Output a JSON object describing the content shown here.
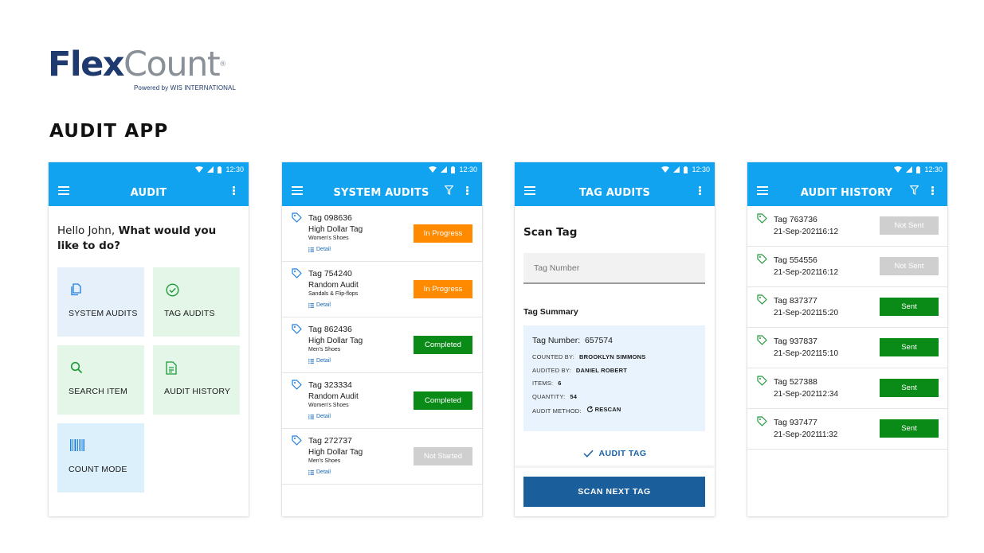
{
  "logo": {
    "part1": "Flex",
    "part2": "Count",
    "tm": "®",
    "tagline": "Powered by WIS INTERNATIONAL"
  },
  "page_title": "AUDIT APP",
  "colors": {
    "appbar": "#12a3f0",
    "in_progress": "#ff8a00",
    "completed": "#0a8a16",
    "not_started": "#cfcfcf",
    "sent": "#0a8a16",
    "not_sent": "#cfcfcf",
    "primary_button": "#1a5f9c",
    "link": "#1769b8"
  },
  "status_bar": {
    "time": "12:30"
  },
  "screen_audit": {
    "title": "AUDIT",
    "greeting_prefix": "Hello John, ",
    "greeting_bold": "What would you like to do?",
    "tiles": [
      {
        "label": "SYSTEM AUDITS",
        "icon": "document-copy-icon"
      },
      {
        "label": "TAG AUDITS",
        "icon": "check-circle-icon"
      },
      {
        "label": "SEARCH ITEM",
        "icon": "search-icon"
      },
      {
        "label": "AUDIT HISTORY",
        "icon": "document-list-icon"
      },
      {
        "label": "COUNT MODE",
        "icon": "barcode-icon"
      }
    ]
  },
  "screen_system_audits": {
    "title": "SYSTEM AUDITS",
    "detail_label": "Detail",
    "items": [
      {
        "tag": "Tag 098636",
        "name": "High Dollar Tag",
        "category": "Women's Shoes",
        "status": "In Progress"
      },
      {
        "tag": "Tag 754240",
        "name": "Random Audit",
        "category": "Sandals & Flip-flops",
        "status": "In Progress"
      },
      {
        "tag": "Tag 862436",
        "name": "High Dollar Tag",
        "category": "Men's Shoes",
        "status": "Completed"
      },
      {
        "tag": "Tag 323334",
        "name": "Random Audit",
        "category": "Women's Shoes",
        "status": "Completed"
      },
      {
        "tag": "Tag 272737",
        "name": "High Dollar Tag",
        "category": "Men's Shoes",
        "status": "Not Started"
      }
    ]
  },
  "screen_tag_audits": {
    "title": "TAG AUDITS",
    "scan_heading": "Scan Tag",
    "input_placeholder": "Tag Number",
    "summary_title": "Tag Summary",
    "tag_number_label": "Tag Number:",
    "tag_number_value": "657574",
    "counted_by_label": "COUNTED BY:",
    "counted_by_value": "BROOKLYN SIMMONS",
    "audited_by_label": "AUDITED BY:",
    "audited_by_value": "DANIEL ROBERT",
    "items_label": "ITEMS:",
    "items_value": "6",
    "quantity_label": "QUANTITY:",
    "quantity_value": "54",
    "method_label": "AUDIT METHOD:",
    "method_value": "RESCAN",
    "audit_tag_label": "AUDIT TAG",
    "scan_next_label": "SCAN NEXT TAG"
  },
  "screen_audit_history": {
    "title": "AUDIT HISTORY",
    "items": [
      {
        "tag": "Tag 763736",
        "date": "21-Sep-2021",
        "time": "16:12",
        "status": "Not Sent"
      },
      {
        "tag": "Tag 554556",
        "date": "21-Sep-2021",
        "time": "16:12",
        "status": "Not Sent"
      },
      {
        "tag": "Tag 837377",
        "date": "21-Sep-2021",
        "time": "15:20",
        "status": "Sent"
      },
      {
        "tag": "Tag 937837",
        "date": "21-Sep-2021",
        "time": "15:10",
        "status": "Sent"
      },
      {
        "tag": "Tag 527388",
        "date": "21-Sep-2021",
        "time": "12:34",
        "status": "Sent"
      },
      {
        "tag": "Tag 937477",
        "date": "21-Sep-2021",
        "time": "11:32",
        "status": "Sent"
      }
    ]
  }
}
